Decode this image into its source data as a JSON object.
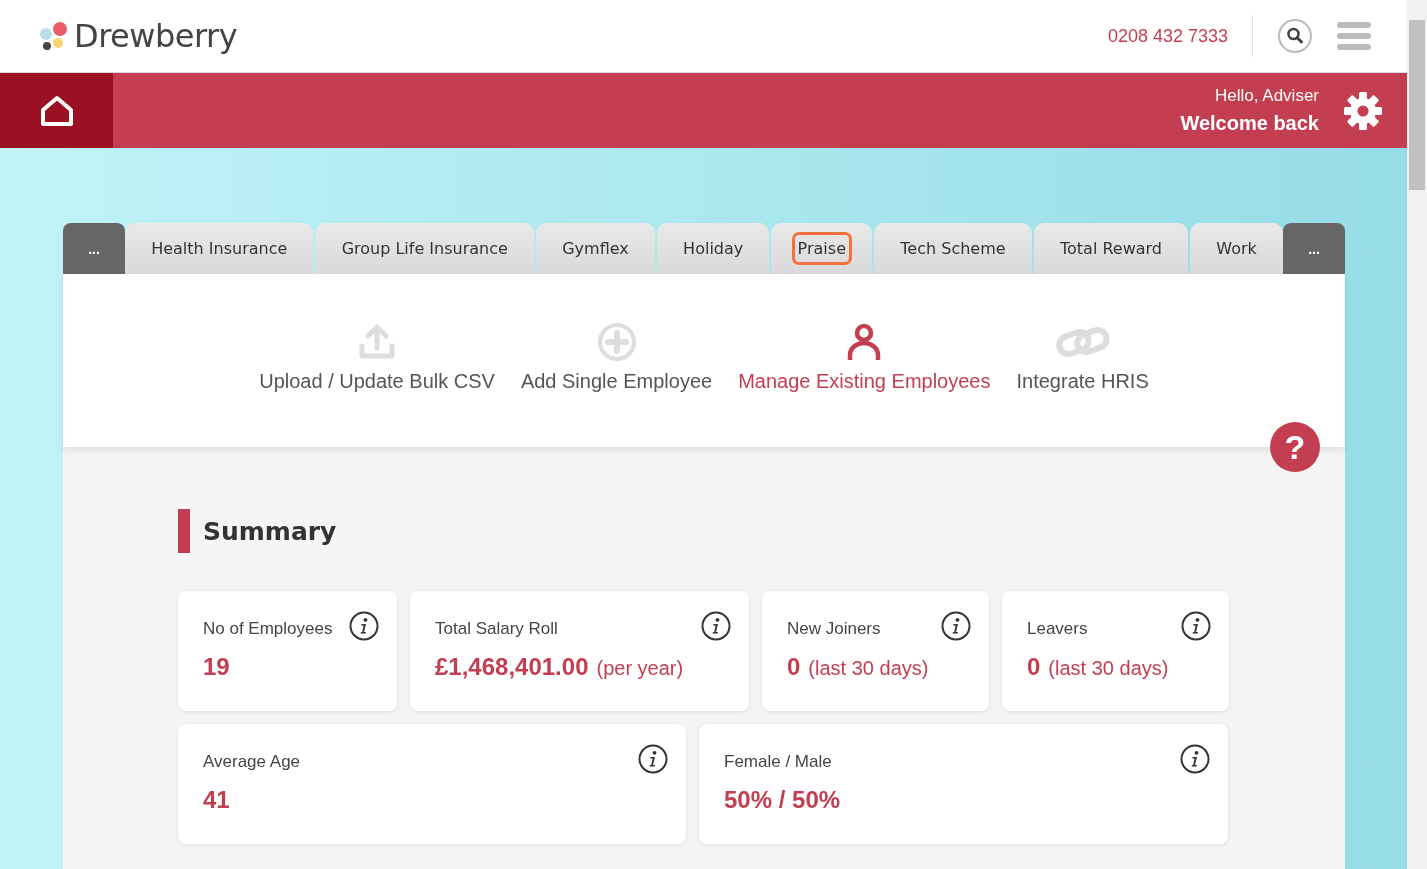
{
  "header": {
    "brand": "Drewberry",
    "phone": "0208 432 7333"
  },
  "banner": {
    "greeting": "Hello, Adviser",
    "welcome": "Welcome back"
  },
  "tab_scroll": {
    "left": "...",
    "right": "..."
  },
  "tabs": [
    {
      "label": "Health Insurance",
      "focused": false
    },
    {
      "label": "Group Life Insurance",
      "focused": false
    },
    {
      "label": "Gymflex",
      "focused": false
    },
    {
      "label": "Holiday",
      "focused": false
    },
    {
      "label": "Praise",
      "focused": true
    },
    {
      "label": "Tech Scheme",
      "focused": false
    },
    {
      "label": "Total Reward",
      "focused": false
    },
    {
      "label": "Work",
      "focused": false
    }
  ],
  "actions": [
    {
      "kind": "upload",
      "label": "Upload / Update Bulk CSV",
      "selected": false
    },
    {
      "kind": "add",
      "label": "Add Single Employee",
      "selected": false
    },
    {
      "kind": "person",
      "label": "Manage Existing Employees",
      "selected": true
    },
    {
      "kind": "link",
      "label": "Integrate HRIS",
      "selected": false
    }
  ],
  "help": "?",
  "summary": {
    "title": "Summary",
    "cards": [
      {
        "label": "No of Employees",
        "value": "19"
      },
      {
        "label": "Total Salary Roll",
        "value": "£1,468,401.00",
        "note": "(per year)"
      },
      {
        "label": "New Joiners",
        "value": "0",
        "note": "(last 30 days)"
      },
      {
        "label": "Leavers",
        "value": "0",
        "note": "(last 30 days)"
      },
      {
        "label": "Average Age",
        "value": "41"
      },
      {
        "label": "Female / Male",
        "value": "50% / 50%"
      }
    ]
  }
}
